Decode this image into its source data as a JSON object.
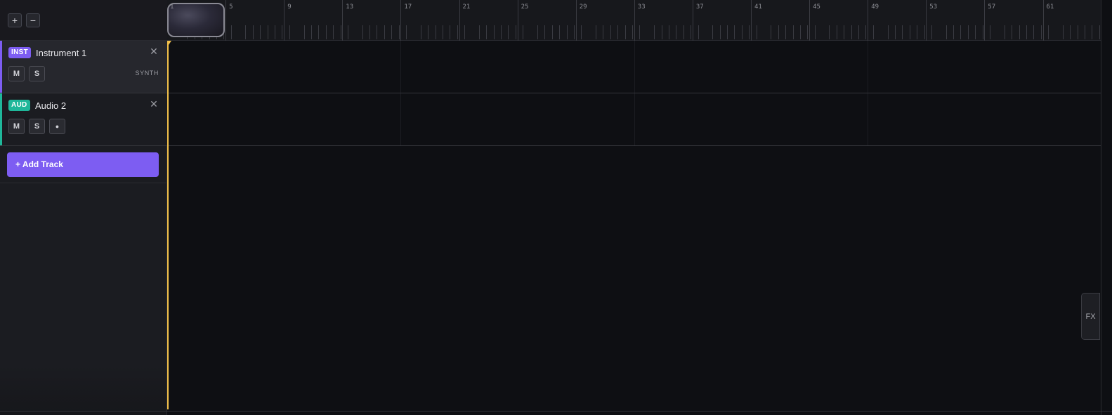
{
  "zoom": {
    "zoom_in": "+",
    "zoom_out": "−"
  },
  "ruler": {
    "bars": [
      "1",
      "5",
      "9",
      "13",
      "17",
      "21",
      "25",
      "29",
      "33",
      "37",
      "41",
      "45",
      "49",
      "53",
      "57",
      "61"
    ]
  },
  "tracks": [
    {
      "badge": "INST",
      "name": "Instrument 1",
      "mute": "M",
      "solo": "S",
      "type_label": "SYNTH",
      "color": "#7d5df2"
    },
    {
      "badge": "AUD",
      "name": "Audio 2",
      "mute": "M",
      "solo": "S",
      "record": "●",
      "color": "#1fb79a"
    }
  ],
  "add_track": {
    "label": "+ Add Track"
  },
  "fx_tab": {
    "label": "FX"
  },
  "colors": {
    "playhead": "#f2c04a",
    "accent": "#7d5df2"
  },
  "icons": {
    "close": "close-icon"
  }
}
